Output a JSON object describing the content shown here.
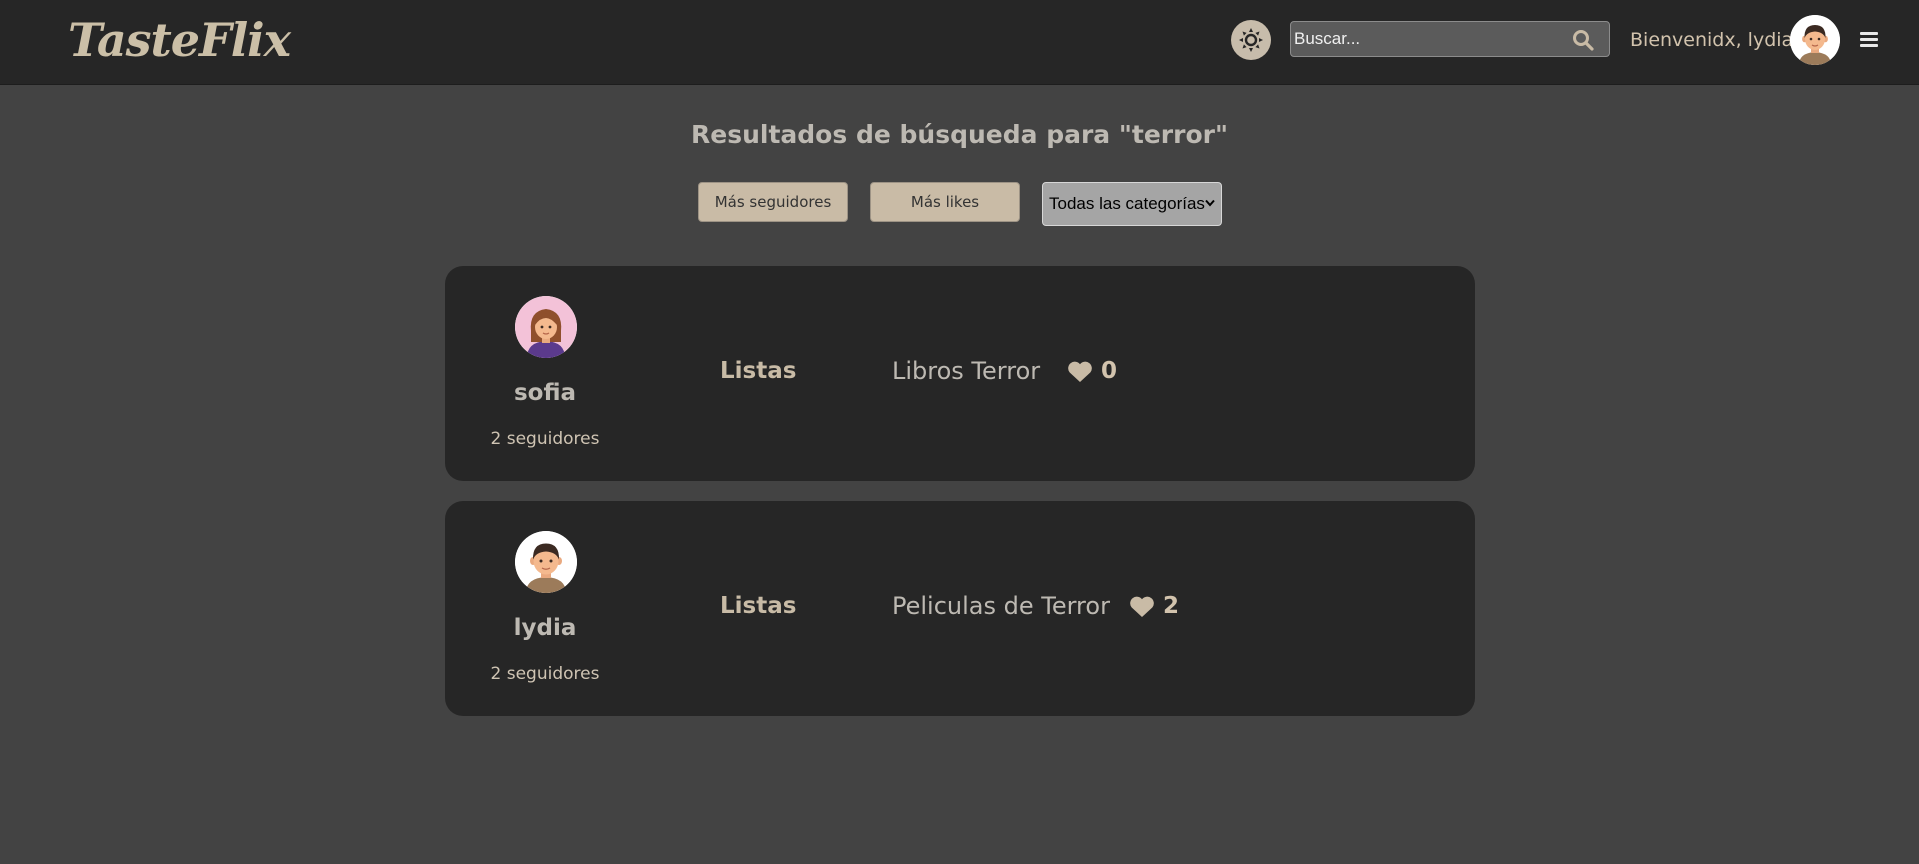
{
  "header": {
    "logo": "TasteFlix",
    "search_placeholder": "Buscar...",
    "welcome": "Bienvenidx, lydia",
    "theme_icon": "sun-icon",
    "search_icon": "search-icon",
    "menu_icon": "menu-icon"
  },
  "main": {
    "title": "Resultados de búsqueda para \"terror\"",
    "filters": {
      "followers_label": "Más seguidores",
      "likes_label": "Más likes",
      "category_selected": "Todas las categorías"
    },
    "results": [
      {
        "username": "sofia",
        "followers": "2 seguidores",
        "section": "Listas",
        "list_name": "Libros Terror",
        "likes": "0",
        "avatar": "female-avatar"
      },
      {
        "username": "lydia",
        "followers": "2 seguidores",
        "section": "Listas",
        "list_name": "Peliculas de Terror",
        "likes": "2",
        "avatar": "male-avatar"
      }
    ]
  },
  "colors": {
    "page_bg": "#434343",
    "header_bg": "#262626",
    "card_bg": "#262626",
    "accent": "#c9bba6",
    "text_light": "#bdb9b2"
  }
}
